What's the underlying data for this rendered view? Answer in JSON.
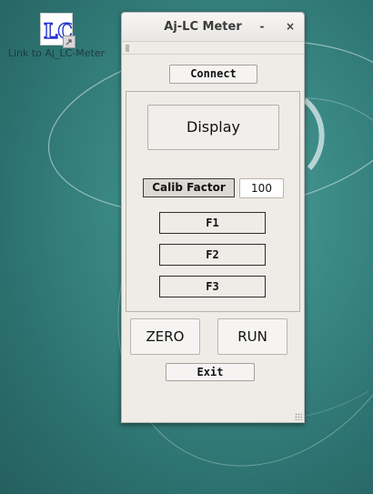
{
  "desktop": {
    "icon": {
      "name": "lc-meter-app-icon",
      "glyph_text": "LC",
      "caption": "Link to Aj_LC-Meter"
    },
    "colors": {
      "background": "#2f7a78",
      "swirl": "#dfeeee"
    }
  },
  "window": {
    "title": "Aj-LC Meter",
    "minimize_glyph": "-",
    "close_glyph": "×",
    "connect_label": "Connect",
    "display_label": "Display",
    "calib": {
      "label": "Calib Factor",
      "value": "100"
    },
    "f_buttons": [
      "F1",
      "F2",
      "F3"
    ],
    "zero_label": "ZERO",
    "run_label": "RUN",
    "exit_label": "Exit",
    "colors": {
      "window_bg": "#efebe7",
      "title_text": "#3c3c3c"
    }
  }
}
